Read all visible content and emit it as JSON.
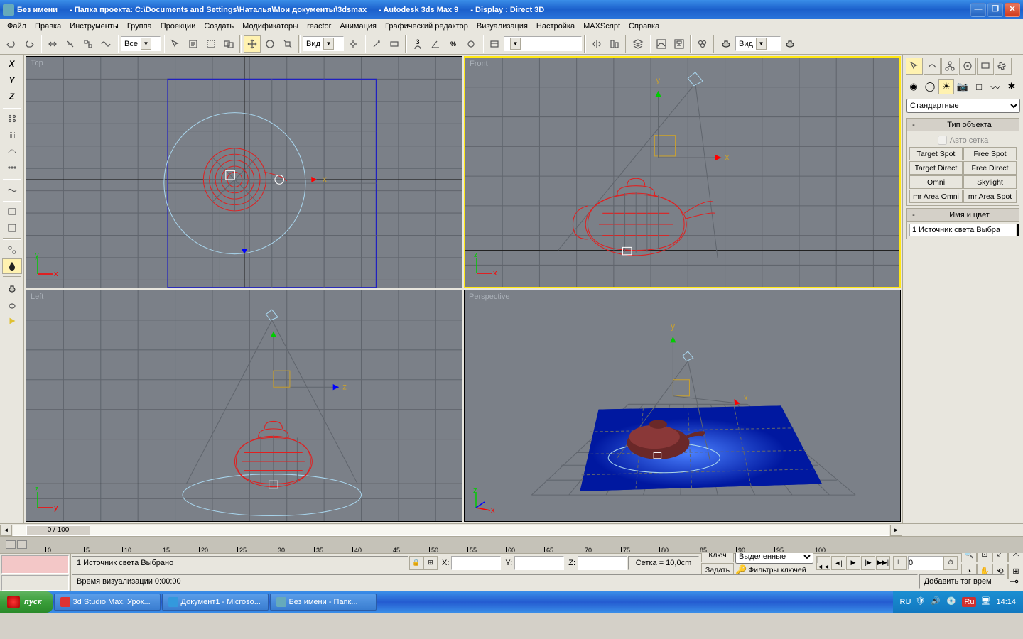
{
  "titlebar": {
    "untitled": "Без имени",
    "project_folder": "- Папка проекта: C:\\Documents and Settings\\Наталья\\Мои документы\\3dsmax",
    "app": "- Autodesk 3ds Max 9",
    "display": "- Display : Direct 3D"
  },
  "menu": [
    "Файл",
    "Правка",
    "Инструменты",
    "Группа",
    "Проекции",
    "Создать",
    "Модификаторы",
    "reactor",
    "Анимация",
    "Графический редактор",
    "Визуализация",
    "Настройка",
    "MAXScript",
    "Справка"
  ],
  "toolbar": {
    "scope_dropdown": "Все",
    "view_label": "Вид",
    "right_view_label": "Вид"
  },
  "left_strip": {
    "x": "X",
    "y": "Y",
    "z": "Z"
  },
  "viewports": {
    "top": "Top",
    "front": "Front",
    "left": "Left",
    "perspective": "Perspective"
  },
  "axes": {
    "x": "x",
    "y": "y",
    "z": "z"
  },
  "right": {
    "dropdown": "Стандартные",
    "rollout1_title": "Тип объекта",
    "autogrid": "Авто сетка",
    "buttons": [
      "Target Spot",
      "Free Spot",
      "Target Direct",
      "Free Direct",
      "Omni",
      "Skylight",
      "mr Area Omni",
      "mr Area Spot"
    ],
    "rollout2_title": "Имя и цвет",
    "name_field": "1 Источник света Выбра"
  },
  "timeline": {
    "frame_readout": "0 / 100",
    "ticks": [
      0,
      5,
      10,
      15,
      20,
      25,
      30,
      35,
      40,
      45,
      50,
      55,
      60,
      65,
      70,
      75,
      80,
      85,
      90,
      95,
      100
    ]
  },
  "status": {
    "selection": "1 Источник света Выбрано",
    "time_label": "Время визуализации  0:00:00",
    "x": "X:",
    "y": "Y:",
    "z": "Z:",
    "grid": "Сетка = 10,0cm",
    "add_tag": "Добавить тэг врем",
    "key_btn": "Ключ",
    "set_btn": "Задать",
    "selected_dropdown": "Выделенные",
    "key_filters": "Фильтры ключей",
    "frame_field": "0"
  },
  "taskbar": {
    "start": "пуск",
    "items": [
      "3d Studio Max. Урок...",
      "Документ1 - Microso...",
      "Без имени      - Папк..."
    ],
    "lang": "RU",
    "lang2": "Ru",
    "clock": "14:14"
  }
}
